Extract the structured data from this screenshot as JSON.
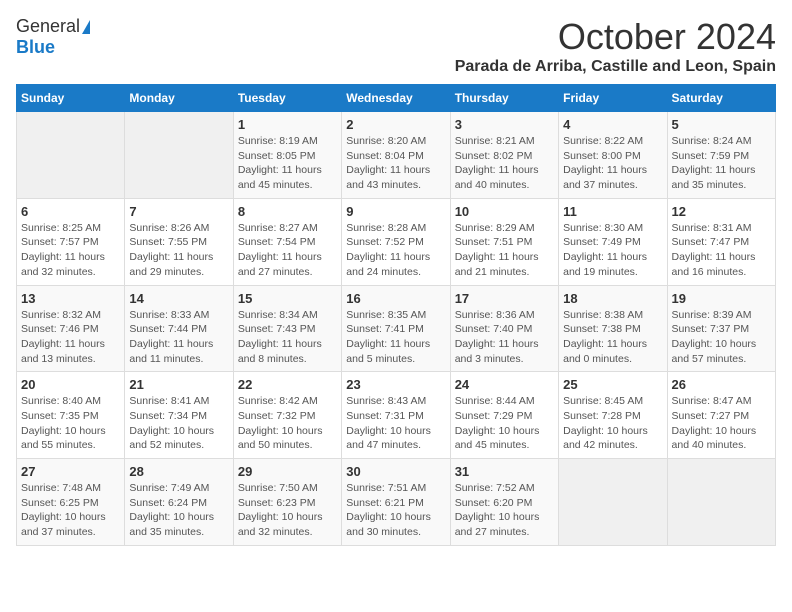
{
  "logo": {
    "general": "General",
    "blue": "Blue"
  },
  "title": "October 2024",
  "location": "Parada de Arriba, Castille and Leon, Spain",
  "days_of_week": [
    "Sunday",
    "Monday",
    "Tuesday",
    "Wednesday",
    "Thursday",
    "Friday",
    "Saturday"
  ],
  "weeks": [
    [
      {
        "day": "",
        "detail": ""
      },
      {
        "day": "",
        "detail": ""
      },
      {
        "day": "1",
        "detail": "Sunrise: 8:19 AM\nSunset: 8:05 PM\nDaylight: 11 hours and 45 minutes."
      },
      {
        "day": "2",
        "detail": "Sunrise: 8:20 AM\nSunset: 8:04 PM\nDaylight: 11 hours and 43 minutes."
      },
      {
        "day": "3",
        "detail": "Sunrise: 8:21 AM\nSunset: 8:02 PM\nDaylight: 11 hours and 40 minutes."
      },
      {
        "day": "4",
        "detail": "Sunrise: 8:22 AM\nSunset: 8:00 PM\nDaylight: 11 hours and 37 minutes."
      },
      {
        "day": "5",
        "detail": "Sunrise: 8:24 AM\nSunset: 7:59 PM\nDaylight: 11 hours and 35 minutes."
      }
    ],
    [
      {
        "day": "6",
        "detail": "Sunrise: 8:25 AM\nSunset: 7:57 PM\nDaylight: 11 hours and 32 minutes."
      },
      {
        "day": "7",
        "detail": "Sunrise: 8:26 AM\nSunset: 7:55 PM\nDaylight: 11 hours and 29 minutes."
      },
      {
        "day": "8",
        "detail": "Sunrise: 8:27 AM\nSunset: 7:54 PM\nDaylight: 11 hours and 27 minutes."
      },
      {
        "day": "9",
        "detail": "Sunrise: 8:28 AM\nSunset: 7:52 PM\nDaylight: 11 hours and 24 minutes."
      },
      {
        "day": "10",
        "detail": "Sunrise: 8:29 AM\nSunset: 7:51 PM\nDaylight: 11 hours and 21 minutes."
      },
      {
        "day": "11",
        "detail": "Sunrise: 8:30 AM\nSunset: 7:49 PM\nDaylight: 11 hours and 19 minutes."
      },
      {
        "day": "12",
        "detail": "Sunrise: 8:31 AM\nSunset: 7:47 PM\nDaylight: 11 hours and 16 minutes."
      }
    ],
    [
      {
        "day": "13",
        "detail": "Sunrise: 8:32 AM\nSunset: 7:46 PM\nDaylight: 11 hours and 13 minutes."
      },
      {
        "day": "14",
        "detail": "Sunrise: 8:33 AM\nSunset: 7:44 PM\nDaylight: 11 hours and 11 minutes."
      },
      {
        "day": "15",
        "detail": "Sunrise: 8:34 AM\nSunset: 7:43 PM\nDaylight: 11 hours and 8 minutes."
      },
      {
        "day": "16",
        "detail": "Sunrise: 8:35 AM\nSunset: 7:41 PM\nDaylight: 11 hours and 5 minutes."
      },
      {
        "day": "17",
        "detail": "Sunrise: 8:36 AM\nSunset: 7:40 PM\nDaylight: 11 hours and 3 minutes."
      },
      {
        "day": "18",
        "detail": "Sunrise: 8:38 AM\nSunset: 7:38 PM\nDaylight: 11 hours and 0 minutes."
      },
      {
        "day": "19",
        "detail": "Sunrise: 8:39 AM\nSunset: 7:37 PM\nDaylight: 10 hours and 57 minutes."
      }
    ],
    [
      {
        "day": "20",
        "detail": "Sunrise: 8:40 AM\nSunset: 7:35 PM\nDaylight: 10 hours and 55 minutes."
      },
      {
        "day": "21",
        "detail": "Sunrise: 8:41 AM\nSunset: 7:34 PM\nDaylight: 10 hours and 52 minutes."
      },
      {
        "day": "22",
        "detail": "Sunrise: 8:42 AM\nSunset: 7:32 PM\nDaylight: 10 hours and 50 minutes."
      },
      {
        "day": "23",
        "detail": "Sunrise: 8:43 AM\nSunset: 7:31 PM\nDaylight: 10 hours and 47 minutes."
      },
      {
        "day": "24",
        "detail": "Sunrise: 8:44 AM\nSunset: 7:29 PM\nDaylight: 10 hours and 45 minutes."
      },
      {
        "day": "25",
        "detail": "Sunrise: 8:45 AM\nSunset: 7:28 PM\nDaylight: 10 hours and 42 minutes."
      },
      {
        "day": "26",
        "detail": "Sunrise: 8:47 AM\nSunset: 7:27 PM\nDaylight: 10 hours and 40 minutes."
      }
    ],
    [
      {
        "day": "27",
        "detail": "Sunrise: 7:48 AM\nSunset: 6:25 PM\nDaylight: 10 hours and 37 minutes."
      },
      {
        "day": "28",
        "detail": "Sunrise: 7:49 AM\nSunset: 6:24 PM\nDaylight: 10 hours and 35 minutes."
      },
      {
        "day": "29",
        "detail": "Sunrise: 7:50 AM\nSunset: 6:23 PM\nDaylight: 10 hours and 32 minutes."
      },
      {
        "day": "30",
        "detail": "Sunrise: 7:51 AM\nSunset: 6:21 PM\nDaylight: 10 hours and 30 minutes."
      },
      {
        "day": "31",
        "detail": "Sunrise: 7:52 AM\nSunset: 6:20 PM\nDaylight: 10 hours and 27 minutes."
      },
      {
        "day": "",
        "detail": ""
      },
      {
        "day": "",
        "detail": ""
      }
    ]
  ]
}
